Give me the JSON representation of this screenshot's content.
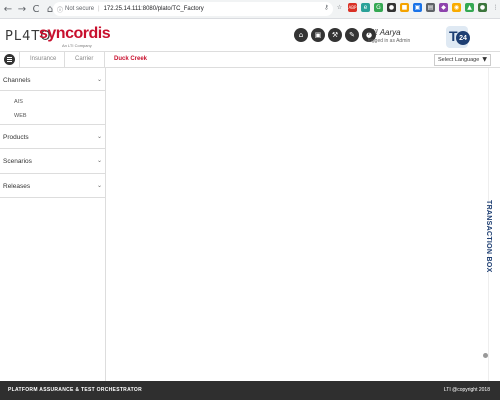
{
  "browser": {
    "back": "←",
    "forward": "→",
    "reload": "C",
    "home": "⌂",
    "info_icon": "ⓘ",
    "security": "Not secure",
    "url": "172.25.14.111:8080/plato/TC_Factory",
    "extensions": [
      {
        "name": "key-icon",
        "glyph": "⚷",
        "color": "#5f6368"
      },
      {
        "name": "star-icon",
        "glyph": "☆",
        "color": "#5f6368"
      },
      {
        "name": "abp-icon",
        "glyph": "ABP",
        "color": "#d93025"
      },
      {
        "name": "ext-teal-icon",
        "glyph": "e",
        "color": "#2aa198"
      },
      {
        "name": "ext-green-icon",
        "glyph": "G",
        "color": "#34a853"
      },
      {
        "name": "ext-dark-icon",
        "glyph": "●",
        "color": "#333333"
      },
      {
        "name": "ext-orange-icon",
        "glyph": "■",
        "color": "#f4a300"
      },
      {
        "name": "ext-blue-icon",
        "glyph": "▣",
        "color": "#1a73e8"
      },
      {
        "name": "ext-gray-icon",
        "glyph": "▤",
        "color": "#5f6368"
      },
      {
        "name": "ext-purple-icon",
        "glyph": "◆",
        "color": "#8e44ad"
      },
      {
        "name": "ext-yellow-icon",
        "glyph": "◉",
        "color": "#f9ab00"
      },
      {
        "name": "ext-green2-icon",
        "glyph": "▲",
        "color": "#34a853"
      },
      {
        "name": "profile-icon",
        "glyph": "●",
        "color": "#3c763d"
      },
      {
        "name": "menu-dots-icon",
        "glyph": "⋮",
        "color": "#5f6368"
      }
    ]
  },
  "header": {
    "logo_plato": "PL4TO",
    "logo_syncordis": "syncordis",
    "logo_tagline": "An LTI Company",
    "greeting": "Hi! Aarya",
    "logged_in": "logged in as Admin",
    "t24_letter": "T",
    "t24_number": "24",
    "icons": [
      {
        "name": "home-icon",
        "glyph": "⌂"
      },
      {
        "name": "briefcase-icon",
        "glyph": "▣"
      },
      {
        "name": "tools-icon",
        "glyph": "⚒"
      },
      {
        "name": "wrench-icon",
        "glyph": "✎"
      },
      {
        "name": "user-icon",
        "glyph": "●"
      }
    ]
  },
  "breadcrumb": {
    "items": [
      "Insurance",
      "Carrier",
      "Duck Creek"
    ],
    "active_index": 2,
    "language": "Select Language",
    "language_caret": "▼"
  },
  "sidebar": {
    "sections": [
      {
        "label": "Channels",
        "expanded": true,
        "items": [
          "AIS",
          "WEB"
        ]
      },
      {
        "label": "Products",
        "expanded": false,
        "items": []
      },
      {
        "label": "Scenarios",
        "expanded": false,
        "items": []
      },
      {
        "label": "Releases",
        "expanded": false,
        "items": []
      }
    ],
    "chevron_open": "⌄",
    "chevron_closed": "⌄"
  },
  "transaction_box": {
    "label": "TRANSACTION BOX"
  },
  "footer": {
    "left": "PLATFORM ASSURANCE & TEST ORCHESTRATOR",
    "right": "LTI @copyright 2018"
  },
  "colors": {
    "brand_red": "#c8102e",
    "t24_blue": "#1e3f73",
    "footer_bg": "#2f2f2f"
  }
}
